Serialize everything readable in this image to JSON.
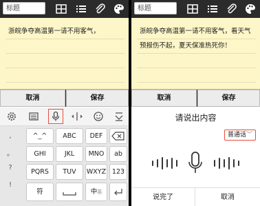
{
  "left": {
    "title_placeholder": "标题",
    "note_text": "浙皖争夺高温第一请不用客气，",
    "cancel_label": "取消",
    "save_label": "保存",
    "keyboard": {
      "row1": [
        "^_^",
        "ABC",
        "DEF"
      ],
      "row2": [
        "GHI",
        "JKL",
        "MNO",
        "ab"
      ],
      "row3": [
        "PQRS",
        "TUV",
        "WXYZ",
        "123"
      ],
      "row4": [
        "符",
        "中",
        "英"
      ],
      "left_column": [
        ",",
        "。",
        "?",
        "!"
      ]
    }
  },
  "right": {
    "title_placeholder": "标题",
    "note_text": "浙皖争夺高温第一请不用客气，看天气预报伤不起，夏天保准热死你！",
    "cancel_label": "取消",
    "save_label": "保存",
    "voice_prompt": "请说出内容",
    "language_label": "普通话",
    "done_label": "说完了",
    "voice_cancel_label": "取消"
  }
}
